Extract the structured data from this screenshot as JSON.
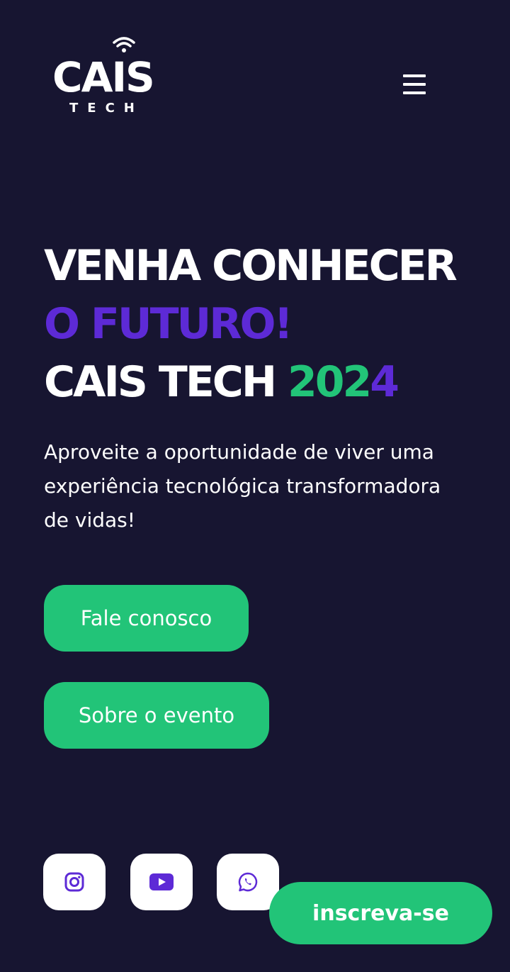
{
  "brand": {
    "name": "CAIS",
    "subtitle": "TECH"
  },
  "header": {
    "menu_icon": "hamburger-menu-icon"
  },
  "hero": {
    "title_line1": "VENHA CONHECER",
    "title_line2": "O FUTURO!",
    "title_line3_prefix": "CAIS TECH ",
    "year_part1": "202",
    "year_part2": "4",
    "description": "Aproveite a oportunidade de viver uma experiência tecnológica transformadora de vidas!"
  },
  "buttons": {
    "contact_label": "Fale conosco",
    "about_label": "Sobre o evento",
    "subscribe_label": "inscreva-se"
  },
  "social": {
    "icons": [
      "instagram-icon",
      "youtube-icon",
      "whatsapp-icon"
    ]
  },
  "colors": {
    "background": "#171531",
    "accent_purple": "#5d2ad6",
    "accent_green": "#22c478",
    "text": "#ffffff"
  }
}
